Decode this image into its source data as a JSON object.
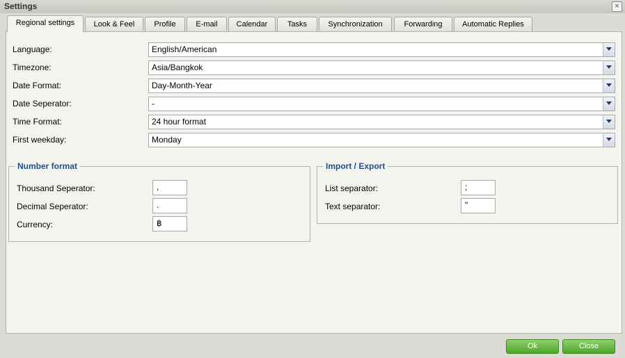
{
  "window": {
    "title": "Settings",
    "close_glyph": "×"
  },
  "tabs": [
    {
      "label": "Regional settings",
      "active": true
    },
    {
      "label": "Look & Feel"
    },
    {
      "label": "Profile"
    },
    {
      "label": "E-mail"
    },
    {
      "label": "Calendar"
    },
    {
      "label": "Tasks"
    },
    {
      "label": "Synchronization"
    },
    {
      "label": "Forwarding"
    },
    {
      "label": "Automatic Replies"
    }
  ],
  "regional": {
    "rows": [
      {
        "label": "Language:",
        "value": "English/American"
      },
      {
        "label": "Timezone:",
        "value": "Asia/Bangkok"
      },
      {
        "label": "Date Format:",
        "value": "Day-Month-Year"
      },
      {
        "label": "Date Seperator:",
        "value": "-"
      },
      {
        "label": "Time Format:",
        "value": "24 hour format"
      },
      {
        "label": "First weekday:",
        "value": "Monday"
      }
    ]
  },
  "number_format": {
    "legend": "Number format",
    "fields": [
      {
        "label": "Thousand Seperator:",
        "value": ","
      },
      {
        "label": "Decimal Seperator:",
        "value": "."
      },
      {
        "label": "Currency:",
        "value": "฿"
      }
    ]
  },
  "import_export": {
    "legend": "Import / Export",
    "fields": [
      {
        "label": "List separator:",
        "value": ";"
      },
      {
        "label": "Text separator:",
        "value": "\""
      }
    ]
  },
  "buttons": {
    "ok": "Ok",
    "close": "Close"
  },
  "colors": {
    "legend": "#1f4f8e",
    "button_green": "#4fa42a"
  }
}
